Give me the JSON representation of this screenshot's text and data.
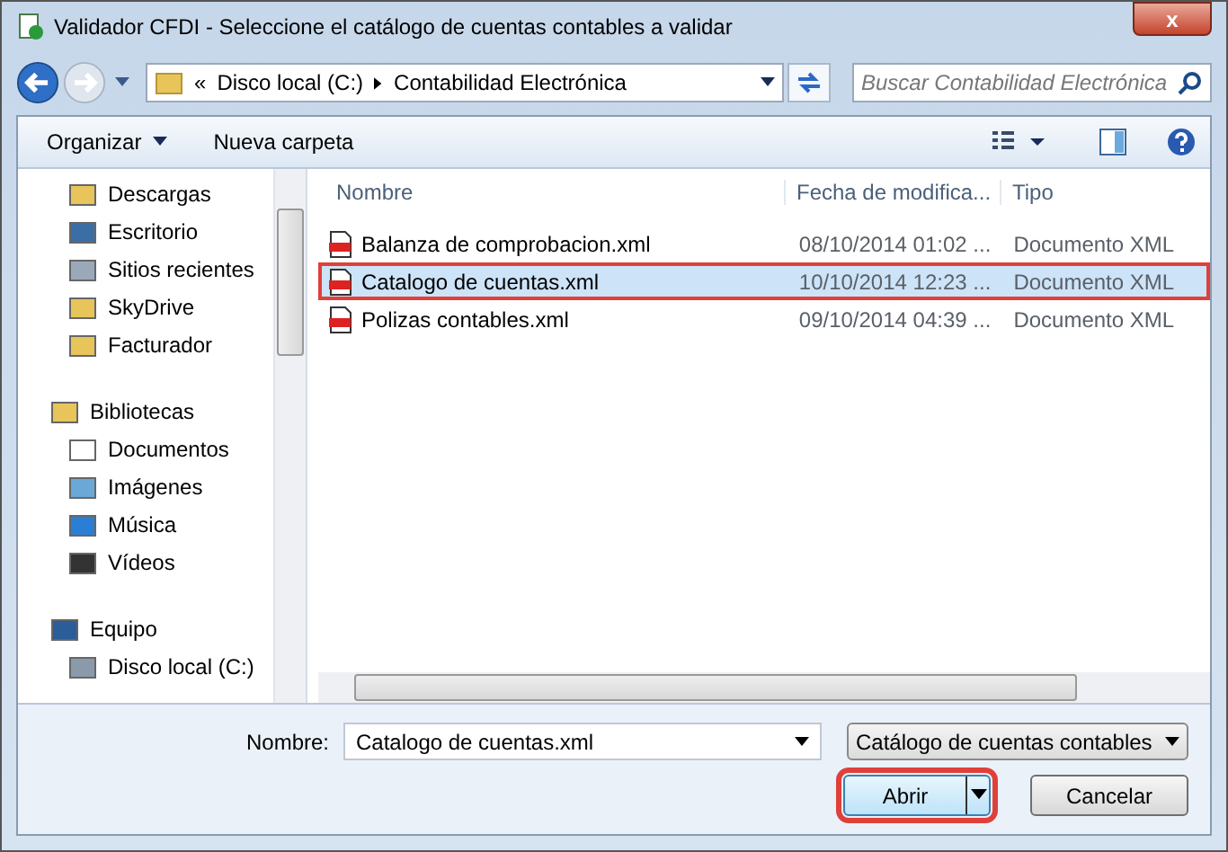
{
  "window": {
    "title": "Validador CFDI - Seleccione el catálogo de cuentas contables a validar",
    "close": "x"
  },
  "address": {
    "overflow": "«",
    "crumbs": [
      "Disco local (C:)",
      "Contabilidad Electrónica"
    ]
  },
  "search": {
    "placeholder": "Buscar Contabilidad Electrónica"
  },
  "toolbar": {
    "organize": "Organizar",
    "new_folder": "Nueva carpeta"
  },
  "sidebar": {
    "sections": [
      {
        "children": [
          {
            "label": "Descargas",
            "kind": "download"
          },
          {
            "label": "Escritorio",
            "kind": "desktop"
          },
          {
            "label": "Sitios recientes",
            "kind": "recent"
          },
          {
            "label": "SkyDrive",
            "kind": "folder"
          },
          {
            "label": "Facturador",
            "kind": "folder"
          }
        ]
      },
      {
        "label": "Bibliotecas",
        "kind": "library",
        "children": [
          {
            "label": "Documentos",
            "kind": "document"
          },
          {
            "label": "Imágenes",
            "kind": "image"
          },
          {
            "label": "Música",
            "kind": "music"
          },
          {
            "label": "Vídeos",
            "kind": "video"
          }
        ]
      },
      {
        "label": "Equipo",
        "kind": "computer",
        "children": [
          {
            "label": "Disco local (C:)",
            "kind": "drive"
          }
        ]
      }
    ]
  },
  "table": {
    "columns": [
      "Nombre",
      "Fecha de modifica...",
      "Tipo"
    ],
    "rows": [
      {
        "name": "Balanza de comprobacion.xml",
        "date": "08/10/2014 01:02 ...",
        "type": "Documento XML",
        "selected": false,
        "highlighted": false
      },
      {
        "name": "Catalogo de cuentas.xml",
        "date": "10/10/2014 12:23 ...",
        "type": "Documento XML",
        "selected": true,
        "highlighted": true
      },
      {
        "name": "Polizas contables.xml",
        "date": "09/10/2014 04:39 ...",
        "type": "Documento XML",
        "selected": false,
        "highlighted": false
      }
    ]
  },
  "filename": {
    "label": "Nombre:",
    "value": "Catalogo de cuentas.xml"
  },
  "filter": {
    "value": "Catálogo de cuentas contables"
  },
  "buttons": {
    "open": {
      "label": "Abrir",
      "highlighted": true
    },
    "cancel": {
      "label": "Cancelar"
    }
  }
}
